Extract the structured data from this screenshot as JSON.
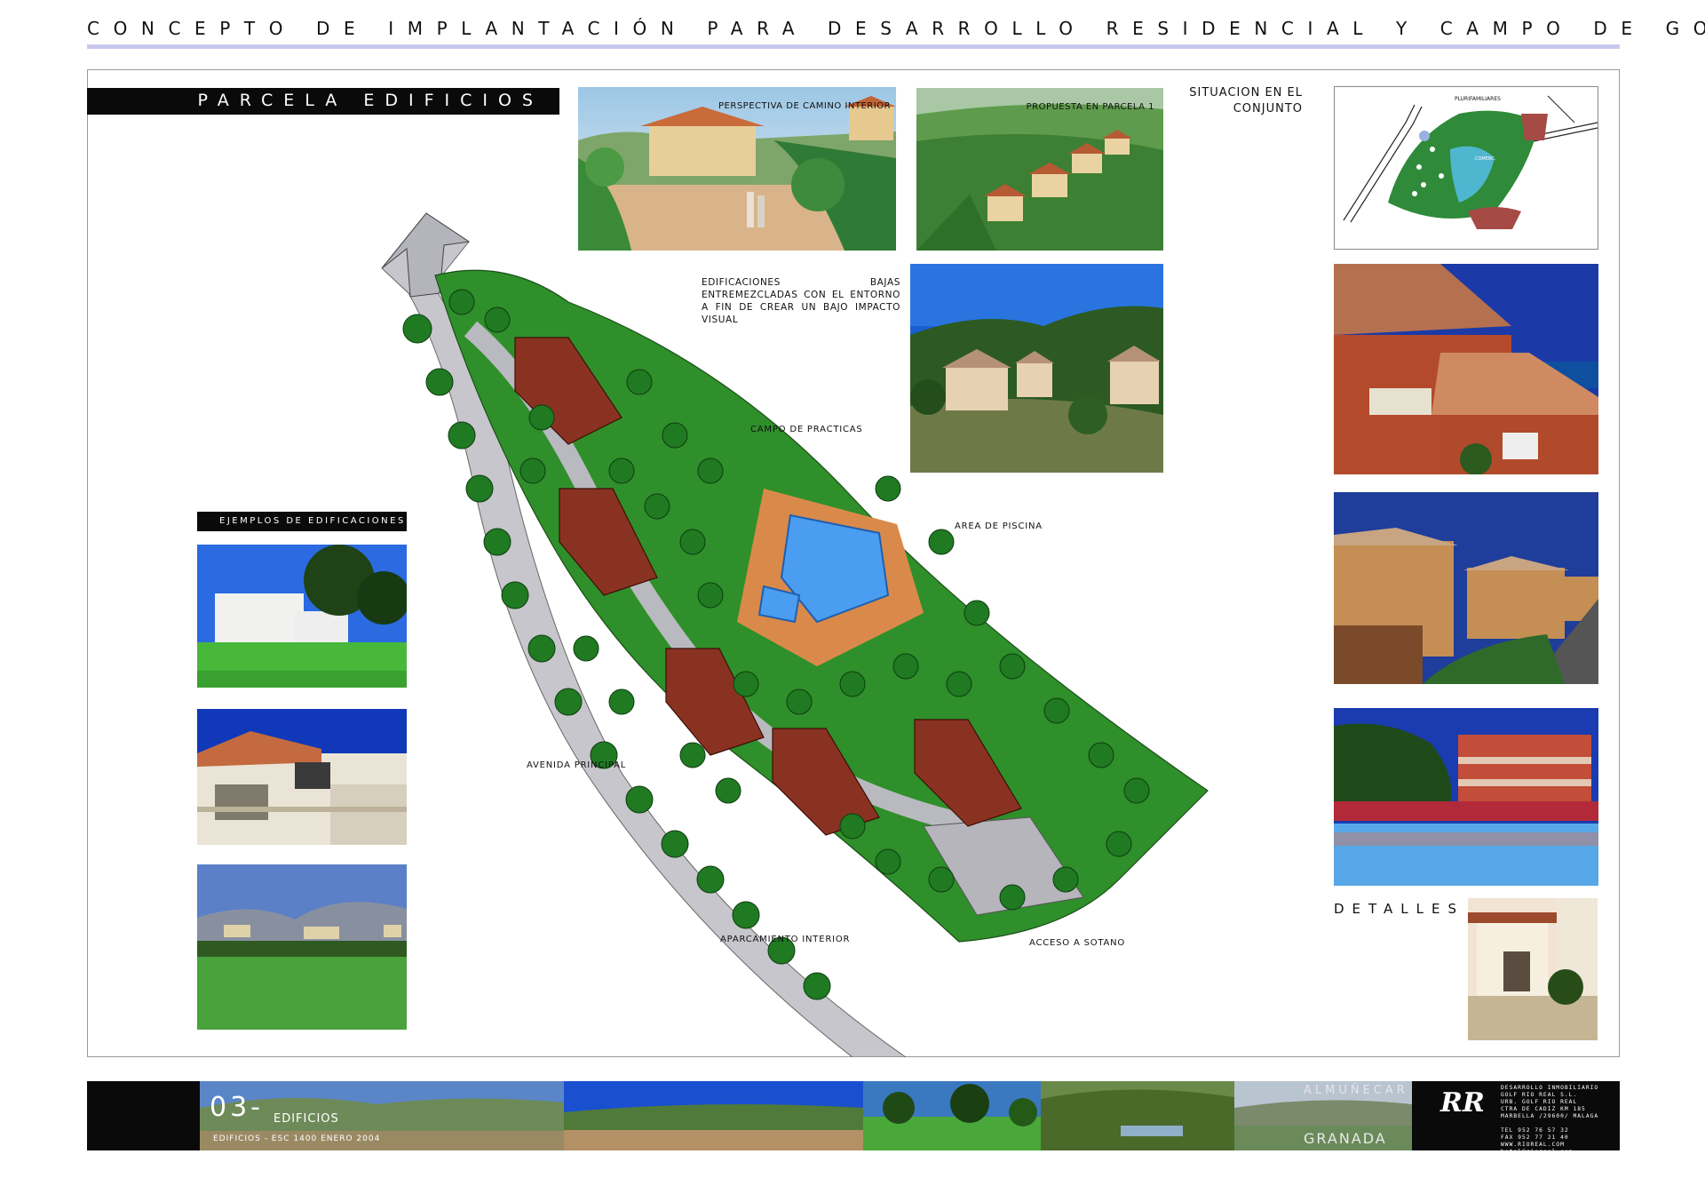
{
  "header": {
    "title": "CONCEPTO DE IMPLANTACIÓN PARA DESARROLLO RESIDENCIAL Y CAMPO DE GOLF"
  },
  "section": {
    "title": "PARCELA EDIFICIOS"
  },
  "captions": {
    "perspectiva": "PERSPECTIVA DE CAMINO INTERIOR",
    "propuesta": "PROPUESTA EN PARCELA 1",
    "situacion_line1": "SITUACION EN EL",
    "situacion_line2": "CONJUNTO",
    "edificaciones_note": "EDIFICACIONES BAJAS ENTREMEZCLADAS CON EL ENTORNO A FIN DE CREAR UN BAJO IMPACTO VISUAL",
    "ejemplos": "EJEMPLOS DE EDIFICACIONES",
    "detalles": "DETALLES"
  },
  "plan_labels": {
    "campo_practicas": "CAMPO DE PRACTICAS",
    "area_piscina": "AREA DE PISCINA",
    "avenida_principal": "AVENIDA PRINCIPAL",
    "aparcamiento": "APARCAMIENTO INTERIOR",
    "acceso_sotano": "ACCESO A SOTANO"
  },
  "map_inset": {
    "label1": "PLURIFAMILIARES",
    "label2": "COMERC."
  },
  "footer": {
    "number": "03-",
    "title": "EDIFICIOS",
    "subtitle": "EDIFICIOS - ESC 1400 ENERO 2004",
    "place1": "ALMUÑECAR",
    "place2": "GRANADA",
    "logo": "RR",
    "company_line1": "DESARROLLO INMOBILIARIO",
    "company_line2": "GOLF RIO REAL S.L.",
    "company_line3": "URB. GOLF RIO REAL",
    "company_line4": "CTRA DE CADIZ KM 185",
    "company_line5": "MARBELLA /29600/ MALAGA",
    "company_line6": "TEL 952 76 57 32",
    "company_line7": "FAX 952 77 21 40",
    "company_line8": "WWW.RIOREAL.COM",
    "company_line9": "hotel@rioreal.com"
  },
  "colors": {
    "accent_line": "#c9c9ef",
    "black_bar": "#0a0a0a",
    "plan_green": "#2f8f2a",
    "roof_red": "#8a3222",
    "pool_blue": "#3f8fe0"
  }
}
